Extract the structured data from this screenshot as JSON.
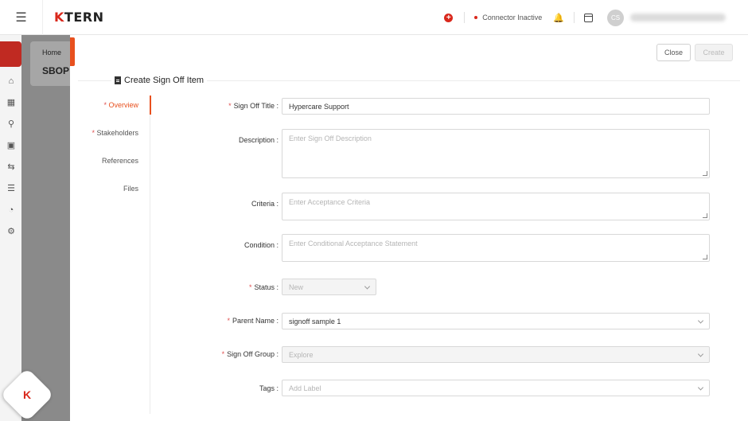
{
  "app": {
    "logo_text": "KTERN",
    "connector_status": "Connector Inactive",
    "avatar_initials": "CS"
  },
  "background": {
    "breadcrumb_home": "Home",
    "breadcrumb_project": "SBOP"
  },
  "drawer": {
    "close_label": "Close",
    "create_label": "Create",
    "title": "Create Sign Off Item"
  },
  "tabs": [
    {
      "label": "Overview",
      "required": true,
      "active": true
    },
    {
      "label": "Stakeholders",
      "required": true,
      "active": false
    },
    {
      "label": "References",
      "required": false,
      "active": false
    },
    {
      "label": "Files",
      "required": false,
      "active": false
    }
  ],
  "form": {
    "sign_off_title": {
      "label": "Sign Off Title",
      "value": "Hypercare Support"
    },
    "description": {
      "label": "Description",
      "placeholder": "Enter Sign Off Description"
    },
    "criteria": {
      "label": "Criteria",
      "placeholder": "Enter Acceptance Criteria"
    },
    "condition": {
      "label": "Condition",
      "placeholder": "Enter Conditional Acceptance Statement"
    },
    "status": {
      "label": "Status",
      "value": "New"
    },
    "parent_name": {
      "label": "Parent Name",
      "value": "signoff sample 1"
    },
    "sign_off_group": {
      "label": "Sign Off Group",
      "value": "Explore"
    },
    "tags": {
      "label": "Tags",
      "placeholder": "Add Label"
    }
  },
  "colors": {
    "accent": "#e8501e",
    "brand_red": "#d9281c",
    "required": "#e05050"
  }
}
